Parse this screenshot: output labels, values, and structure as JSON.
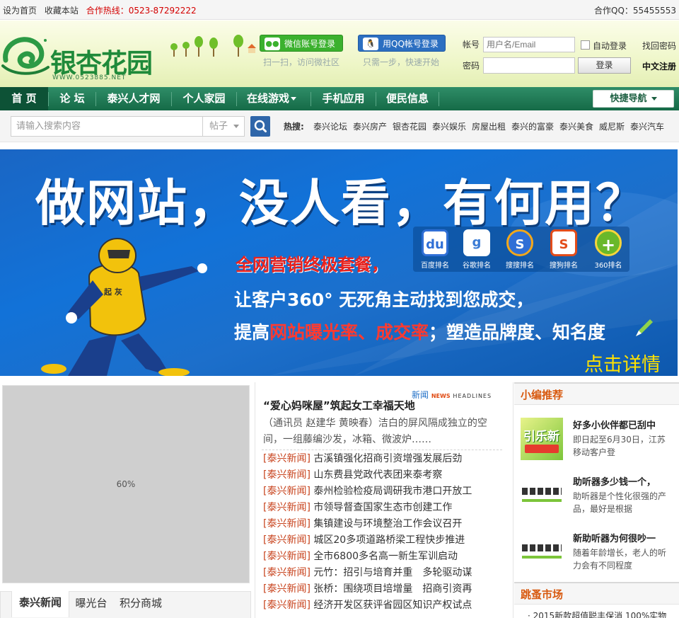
{
  "topbar": {
    "set_home": "设为首页",
    "bookmark": "收藏本站",
    "hotline": "合作热线：0523-87292222",
    "qq": "合作QQ：55455553"
  },
  "header": {
    "logo_text": "银杏花园",
    "logo_url": "WWW.0523885.NET",
    "wechat_login": "微信账号登录",
    "wechat_sub": "扫一扫，访问微社区",
    "qq_login": "用QQ帐号登录",
    "qq_sub": "只需一步，快速开始",
    "account_label": "帐号",
    "account_placeholder": "用户名/Email",
    "password_label": "密码",
    "auto_login": "自动登录",
    "forgot": "找回密码",
    "login": "登录",
    "register": "中文注册"
  },
  "nav": {
    "items": [
      "首 页",
      "论 坛",
      "泰兴人才网",
      "个人家园",
      "在线游戏",
      "手机应用",
      "便民信息"
    ],
    "quick": "快捷导航"
  },
  "search": {
    "placeholder": "请输入搜索内容",
    "type": "帖子",
    "hot_label": "热搜:",
    "keywords": [
      "泰兴论坛",
      "泰兴房产",
      "银杏花园",
      "泰兴娱乐",
      "房屋出租",
      "泰兴的富豪",
      "泰兴美食",
      "威尼斯",
      "泰兴汽车"
    ]
  },
  "banner": {
    "title": "做网站，没人看，有何用？",
    "red": "全网营销终极套餐，",
    "line1": "让客户360° 无死角主动找到您成交，",
    "line2_a": "提高",
    "line2_b": "网站曝光率、成交率",
    "line2_c": "；塑造品牌度、知名度",
    "cta": "点击详情",
    "figure_label": "起 灰",
    "engines": [
      {
        "label": "百度排名",
        "icon": "du"
      },
      {
        "label": "谷歌排名",
        "icon": "g"
      },
      {
        "label": "搜搜排名",
        "icon": "S"
      },
      {
        "label": "搜狗排名",
        "icon": "S"
      },
      {
        "label": "360排名",
        "icon": "+"
      }
    ],
    "colors": {
      "engine_bg": [
        "#2f6fd6",
        "#3a9e3a",
        "#f3a81a",
        "#e24c1a",
        "#6ab82a"
      ]
    }
  },
  "left": {
    "image_text": "60%",
    "tabs": [
      "泰兴新闻",
      "曝光台",
      "积分商城"
    ]
  },
  "news": {
    "logo_cn": "新闻",
    "logo_en1": "NEWS",
    "logo_en2": "HEADLINES",
    "headline": "“爱心妈咪屋”筑起女工幸福天地",
    "summary": "（通讯员 赵建华 黄映春）洁白的屏风隔成独立的空间，一组藤编沙发，冰箱、微波炉……",
    "items": [
      {
        "cat": "[泰兴新闻]",
        "title": "古溪镇强化招商引资增强发展后劲"
      },
      {
        "cat": "[泰兴新闻]",
        "title": "山东费县党政代表团来泰考察"
      },
      {
        "cat": "[泰兴新闻]",
        "title": "泰州检验检疫局调研我市港口开放工"
      },
      {
        "cat": "[泰兴新闻]",
        "title": "市领导督查国家生态市创建工作"
      },
      {
        "cat": "[泰兴新闻]",
        "title": "集镇建设与环境整治工作会议召开"
      },
      {
        "cat": "[泰兴新闻]",
        "title": "城区20多项道路桥梁工程快步推进"
      },
      {
        "cat": "[泰兴新闻]",
        "title": "全市6800多名高一新生军训启动"
      },
      {
        "cat": "[泰兴新闻]",
        "title": "元竹：招引与培育并重　多轮驱动谋"
      },
      {
        "cat": "[泰兴新闻]",
        "title": "张桥：围绕项目培增量　招商引资再"
      },
      {
        "cat": "[泰兴新闻]",
        "title": "经济开发区获评省园区知识产权试点"
      }
    ]
  },
  "recommend": {
    "heading": "小编推荐",
    "items": [
      {
        "title": "好多小伙伴都已刮中",
        "desc": "即日起至6月30日，江苏移动客户登"
      },
      {
        "title": "助听器多少钱一个，",
        "desc": "助听器是个性化很强的产品，最好是根据"
      },
      {
        "title": "新助听器为何很吵一",
        "desc": "随着年龄增长，老人的听力会有不同程度"
      }
    ]
  },
  "market": {
    "heading": "跳蚤市场",
    "item": "· 2015新款超值聪丰保消 100%实物"
  }
}
